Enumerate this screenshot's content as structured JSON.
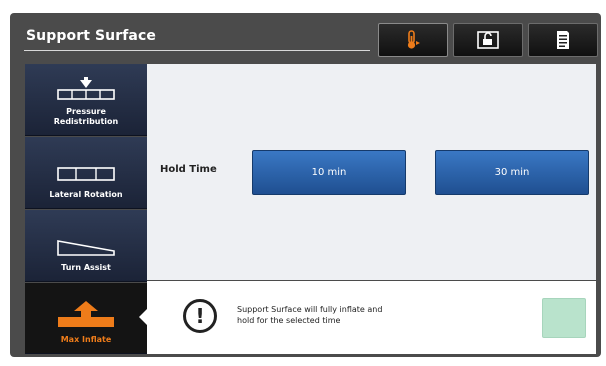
{
  "header": {
    "title": "Support Surface",
    "buttons": [
      {
        "name": "thermometer-icon",
        "active": true
      },
      {
        "name": "unlock-icon",
        "active": false
      },
      {
        "name": "document-icon",
        "active": false
      }
    ],
    "accent": "#ee7c1a"
  },
  "sidebar": {
    "items": [
      {
        "label": "Pressure\nRedistribution",
        "icon": "pressure-redistribution-icon"
      },
      {
        "label": "Lateral Rotation",
        "icon": "lateral-rotation-icon"
      },
      {
        "label": "Turn Assist",
        "icon": "turn-assist-icon"
      },
      {
        "label": "Max Inflate",
        "icon": "max-inflate-icon",
        "selected": true
      }
    ]
  },
  "main": {
    "hold_label": "Hold Time",
    "options": [
      "10 min",
      "30 min"
    ]
  },
  "message": {
    "line1": "Support Surface will fully inflate and",
    "line2": "hold for the selected time",
    "icon": "info-icon"
  },
  "colors": {
    "button_blue": "#2a63ae",
    "sidebar_navy": "#26304a",
    "confirm_green": "#b9e3cc"
  }
}
